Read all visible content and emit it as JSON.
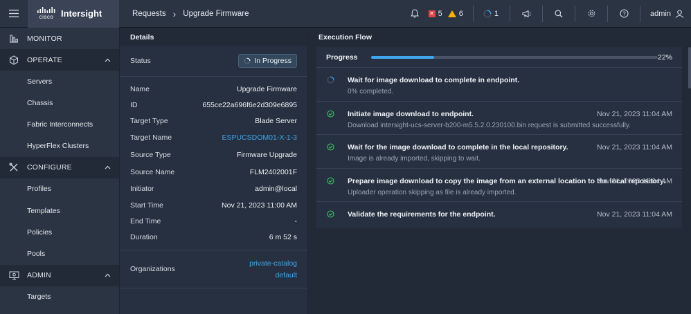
{
  "header": {
    "brand_company": "cisco",
    "brand_product": "Intersight",
    "breadcrumb": [
      "Requests",
      "Upgrade Firmware"
    ],
    "critical_alarm_count": "5",
    "warning_alarm_count": "6",
    "active_requests_count": "1",
    "user_name": "admin",
    "icons": [
      "hamburger-menu-icon",
      "bell-icon",
      "critical-alarm-icon",
      "warning-alarm-icon",
      "spinner-icon",
      "megaphone-icon",
      "search-icon",
      "gear-icon",
      "help-icon",
      "user-icon"
    ]
  },
  "sidebar": {
    "sections": [
      {
        "label": "MONITOR",
        "icon": "bar-chart-icon",
        "items": []
      },
      {
        "label": "OPERATE",
        "icon": "cube-icon",
        "items": [
          "Servers",
          "Chassis",
          "Fabric Interconnects",
          "HyperFlex Clusters"
        ]
      },
      {
        "label": "CONFIGURE",
        "icon": "tools-icon",
        "items": [
          "Profiles",
          "Templates",
          "Policies",
          "Pools"
        ]
      },
      {
        "label": "ADMIN",
        "icon": "monitor-gear-icon",
        "items": [
          "Targets"
        ]
      }
    ]
  },
  "details": {
    "title": "Details",
    "status_label": "Status",
    "status_value": "In Progress",
    "rows": [
      {
        "label": "Name",
        "value": "Upgrade Firmware"
      },
      {
        "label": "ID",
        "value": "655ce22a696f6e2d309e6895"
      },
      {
        "label": "Target Type",
        "value": "Blade Server"
      },
      {
        "label": "Target Name",
        "value": "ESPUCSDOM01-X-1-3"
      },
      {
        "label": "Source Type",
        "value": "Firmware Upgrade"
      },
      {
        "label": "Source Name",
        "value": "FLM2402001F"
      },
      {
        "label": "Initiator",
        "value": "admin@local"
      },
      {
        "label": "Start Time",
        "value": "Nov 21, 2023 11:00 AM"
      },
      {
        "label": "End Time",
        "value": "-"
      },
      {
        "label": "Duration",
        "value": "6 m 52 s"
      }
    ],
    "organizations_label": "Organizations",
    "organizations": [
      "private-catalog",
      "default"
    ]
  },
  "execution_flow": {
    "title": "Execution Flow",
    "progress_label": "Progress",
    "progress_percent": 22,
    "progress_text": "22%",
    "steps": [
      {
        "state": "in-progress",
        "title": "Wait for image download to complete in endpoint.",
        "desc": "0% completed.",
        "time": ""
      },
      {
        "state": "success",
        "title": "Initiate image download to endpoint.",
        "desc": "Download intersight-ucs-server-b200-m5.5.2.0.230100.bin request is submitted successfully.",
        "time": "Nov 21, 2023 11:04 AM"
      },
      {
        "state": "success",
        "title": "Wait for the image download to complete in the local repository.",
        "desc": "Image is already imported, skipping to wait.",
        "time": "Nov 21, 2023 11:04 AM"
      },
      {
        "state": "success",
        "title": "Prepare image download to copy the image from an external location to the local repository.",
        "desc": "Uploader operation skipping as file is already imported.",
        "time": "Nov 21, 2023 11:04 AM"
      },
      {
        "state": "success",
        "title": "Validate the requirements for the endpoint.",
        "desc": "",
        "time": "Nov 21, 2023 11:04 AM"
      }
    ]
  },
  "colors": {
    "accent": "#3fa6ee",
    "success": "#3fbf6a",
    "critical": "#e04444",
    "warning": "#f5b400"
  }
}
